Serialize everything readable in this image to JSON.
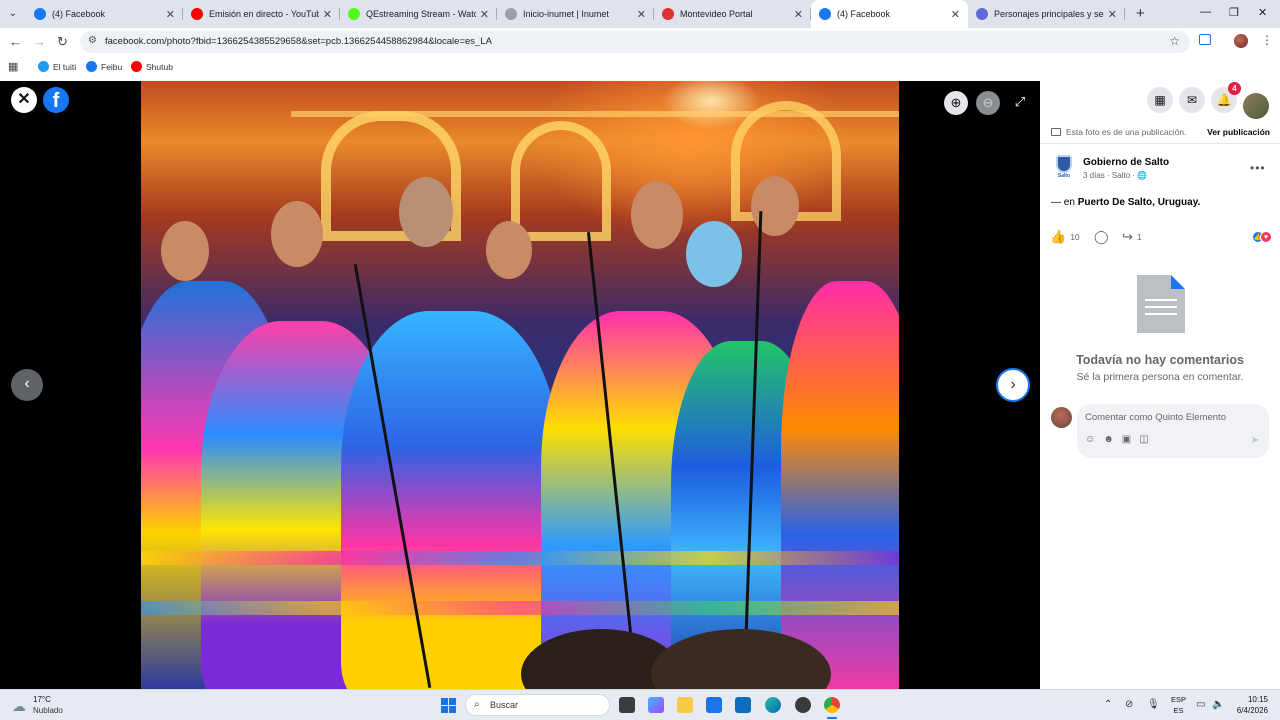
{
  "browser": {
    "tabs": [
      {
        "title": "(4) Facebook",
        "favicon": "facebook-icon",
        "color": "#1877f2",
        "active": false
      },
      {
        "title": "Emisión en directo - YouTube Studio",
        "favicon": "youtube-icon",
        "color": "#ff0000",
        "active": false
      },
      {
        "title": "QEstreaming Stream - Watch",
        "favicon": "kick-icon",
        "color": "#53fc18",
        "active": false
      },
      {
        "title": "Inicio-inumet | Inumet",
        "favicon": "page-icon",
        "color": "#9aa0a6",
        "active": false
      },
      {
        "title": "Montevideo Portal",
        "favicon": "montevideo-icon",
        "color": "#e03131",
        "active": false
      },
      {
        "title": "(4) Facebook",
        "favicon": "facebook-icon",
        "color": "#1877f2",
        "active": true
      },
      {
        "title": "Personajes principales y secundarios",
        "favicon": "generic-icon",
        "color": "#5f6bd6",
        "active": false
      }
    ],
    "url": "facebook.com/photo?fbid=1366254385529658&set=pcb.1366254458862984&locale=es_LA",
    "bookmarks": [
      {
        "label": "El tuiti",
        "icon": "twitter-icon",
        "color": "#1d9bf0"
      },
      {
        "label": "Feibu",
        "icon": "facebook-icon",
        "color": "#1877f2"
      },
      {
        "label": "Shutub",
        "icon": "youtube-icon",
        "color": "#ff0000"
      }
    ]
  },
  "viewer": {
    "close_glyph": "✕",
    "logo_glyph": "f",
    "zoom_in_glyph": "⊕",
    "zoom_out_glyph": "⊖",
    "fullscreen_glyph": "⤢",
    "prev_glyph": "‹",
    "next_glyph": "›"
  },
  "panel": {
    "notification_count": "4",
    "publication_note": "Esta foto es de una publicación.",
    "view_publication": "Ver publicación",
    "page_name": "Gobierno de Salto",
    "page_logo_label": "Salto",
    "page_meta": "3 días · Salto · 🌐",
    "location_prefix": "— en ",
    "location": "Puerto De Salto, Uruguay.",
    "likes": "10",
    "shares": "1",
    "no_comments_title": "Todavía no hay comentarios",
    "no_comments_sub": "Sé la primera persona en comentar.",
    "comment_placeholder": "Comentar como Quinto Elemento"
  },
  "taskbar": {
    "temperature": "17°C",
    "weather": "Nublado",
    "search_placeholder": "Buscar",
    "language_top": "ESP",
    "language_bottom": "ES",
    "time": "10:15",
    "date": "6/4/2026"
  }
}
